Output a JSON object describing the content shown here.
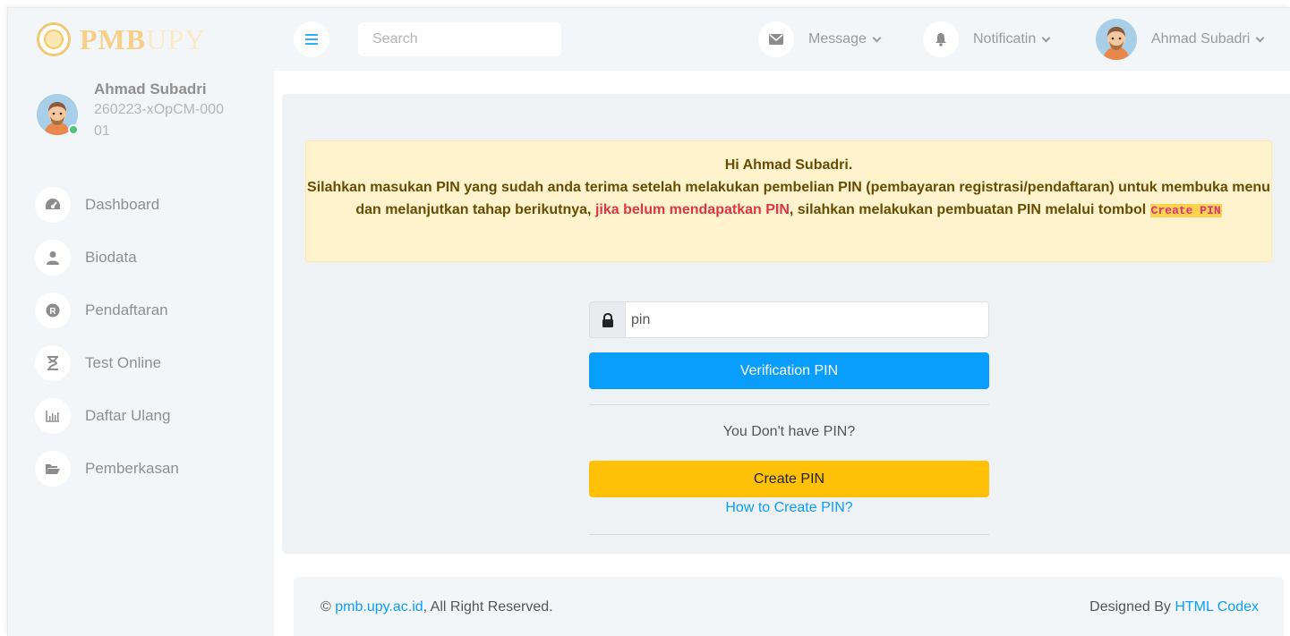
{
  "brand": {
    "text_main": "PMB",
    "text_faint": "UPY"
  },
  "profile": {
    "name": "Ahmad Subadri",
    "id": "260223-xOpCM-00001"
  },
  "sidebar": {
    "items": [
      {
        "label": "Dashboard",
        "icon": "dashboard-icon"
      },
      {
        "label": "Biodata",
        "icon": "user-icon"
      },
      {
        "label": "Pendaftaran",
        "icon": "registered-icon"
      },
      {
        "label": "Test Online",
        "icon": "hourglass-icon"
      },
      {
        "label": "Daftar Ulang",
        "icon": "chart-icon"
      },
      {
        "label": "Pemberkasan",
        "icon": "folder-open-icon"
      }
    ]
  },
  "topbar": {
    "search_placeholder": "Search",
    "message_label": "Message",
    "notification_label": "Notificatin",
    "user_label": "Ahmad Subadri"
  },
  "alert": {
    "greeting": "Hi Ahmad Subadri.",
    "text_part1": "Silahkan masukan PIN yang sudah anda terima setelah melakukan pembelian PIN (pembayaran registrasi/pendaftaran) untuk membuka menu dan melanjutkan tahap berikutnya, ",
    "text_red": "jika belum mendapatkan PIN",
    "text_part2": ", silahkan melakukan pembuatan PIN melalui tombol ",
    "code_label": "Create PIN"
  },
  "pin_form": {
    "pin_placeholder": "pin",
    "verify_label": "Verification PIN",
    "no_pin_text": "You Don't have PIN?",
    "create_label": "Create PIN",
    "how_to_label": "How to Create PIN?"
  },
  "footer": {
    "copyright_symbol": "©",
    "site_link": "pmb.upy.ac.id",
    "rights": ", All Right Reserved.",
    "designed_by": "Designed By ",
    "designer_link": "HTML Codex"
  },
  "colors": {
    "accent": "#0a9efc",
    "warning_button": "#ffc107",
    "alert_bg": "#fff3cd",
    "alert_red": "#dc3545"
  }
}
